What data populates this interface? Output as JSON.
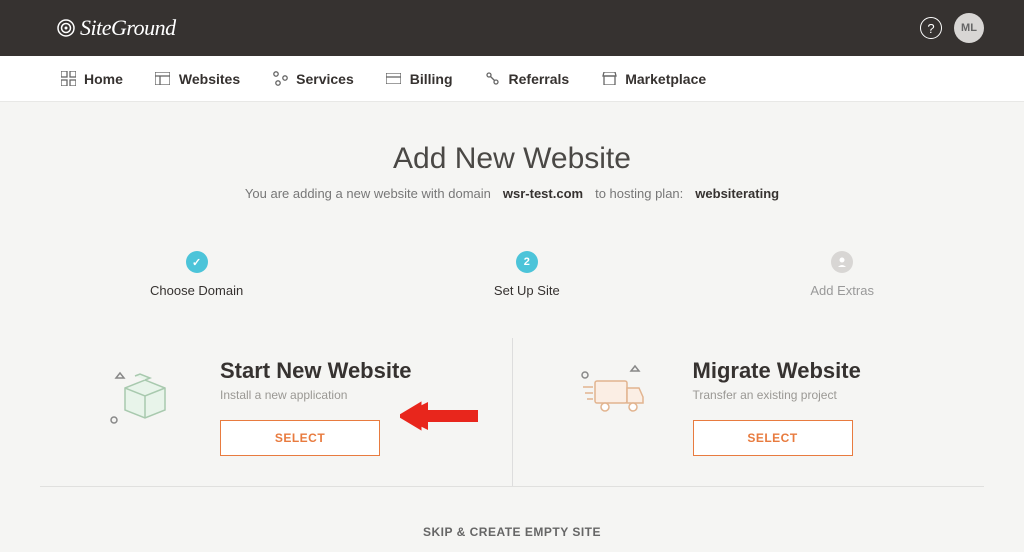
{
  "header": {
    "logo_text": "SiteGround",
    "help_label": "?",
    "avatar_initials": "ML"
  },
  "nav": {
    "items": [
      {
        "label": "Home"
      },
      {
        "label": "Websites"
      },
      {
        "label": "Services"
      },
      {
        "label": "Billing"
      },
      {
        "label": "Referrals"
      },
      {
        "label": "Marketplace"
      }
    ]
  },
  "page": {
    "title": "Add New Website",
    "subtitle_prefix": "You are adding a new website with domain",
    "domain": "wsr-test.com",
    "subtitle_mid": "to hosting plan:",
    "plan": "websiterating"
  },
  "steps": [
    {
      "label": "Choose Domain",
      "state": "completed",
      "badge": "✓"
    },
    {
      "label": "Set Up Site",
      "state": "active",
      "badge": "2"
    },
    {
      "label": "Add Extras",
      "state": "inactive",
      "badge": ""
    }
  ],
  "options": [
    {
      "title": "Start New Website",
      "subtitle": "Install a new application",
      "button": "SELECT"
    },
    {
      "title": "Migrate Website",
      "subtitle": "Transfer an existing project",
      "button": "SELECT"
    }
  ],
  "skip_label": "SKIP & CREATE EMPTY SITE"
}
